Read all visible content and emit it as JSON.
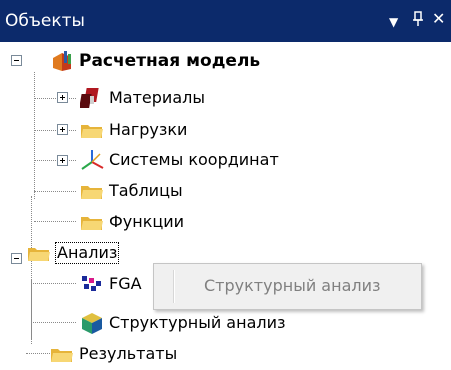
{
  "panel": {
    "title": "Объекты",
    "dropdown_glyph": "▼",
    "pin_glyph": "ᵖ",
    "close_glyph": "✕"
  },
  "tree": {
    "root": {
      "label": "Расчетная модель",
      "icon": "model-icon"
    },
    "items": [
      {
        "label": "Материалы",
        "icon": "materials-icon",
        "expandable": true
      },
      {
        "label": "Нагрузки",
        "icon": "folder-icon",
        "expandable": true
      },
      {
        "label": "Системы координат",
        "icon": "coordinate-axes-icon",
        "expandable": true
      },
      {
        "label": "Таблицы",
        "icon": "folder-icon",
        "expandable": false
      },
      {
        "label": "Функции",
        "icon": "folder-icon",
        "expandable": false
      }
    ],
    "analysis": {
      "label": "Анализ",
      "icon": "folder-icon",
      "children": [
        {
          "label": "FGA",
          "icon": "fga-icon"
        },
        {
          "label": "Структурный анализ",
          "icon": "structural-analysis-icon"
        }
      ]
    },
    "results": {
      "label": "Результаты",
      "icon": "folder-icon"
    }
  },
  "context_menu": {
    "items": [
      {
        "label": "Структурный анализ",
        "enabled": false
      }
    ]
  },
  "colors": {
    "titlebar": "#0c2a6b",
    "folder": "#f4c64a",
    "menu_background": "#f0f0f0"
  }
}
